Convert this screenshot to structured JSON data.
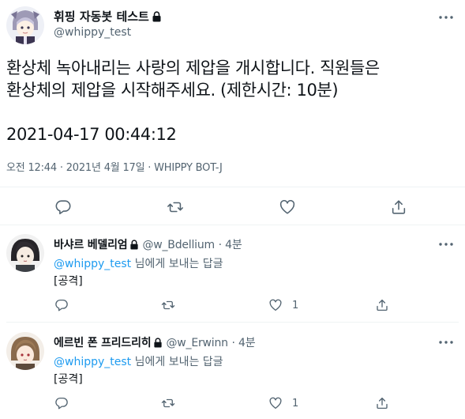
{
  "main": {
    "display_name": "휘핑 자동봇 테스트",
    "handle": "@whippy_test",
    "text_line1": "환상체 녹아내리는 사랑의 제압을 개시합니다. 직원들은",
    "text_line2": "환상체의 제압을 시작해주세요. (제한시간: 10분)",
    "text_line3": "2021-04-17 00:44:12",
    "meta": "오전 12:44 · 2021년 4월 17일 · WHIPPY BOT-J"
  },
  "replies": [
    {
      "display_name": "바샤르 베델리엄",
      "handle": "@w_Bdellium",
      "time": "· 4분",
      "mention": "@whippy_test",
      "reply_to": " 님에게 보내는 답글",
      "body": "[공격]",
      "like_count": "1"
    },
    {
      "display_name": "에르빈 폰 프리드리히",
      "handle": "@w_Erwinn",
      "time": "· 4분",
      "mention": "@whippy_test",
      "reply_to": " 님에게 보내는 답글",
      "body": "[공격]",
      "like_count": "1"
    }
  ],
  "colors": {
    "text": "#0f1419",
    "muted": "#536471",
    "link": "#1d9bf0",
    "separator": "#eff3f4"
  },
  "icons": [
    "lock-icon",
    "more-icon",
    "reply-icon",
    "retweet-icon",
    "like-icon",
    "share-icon"
  ]
}
